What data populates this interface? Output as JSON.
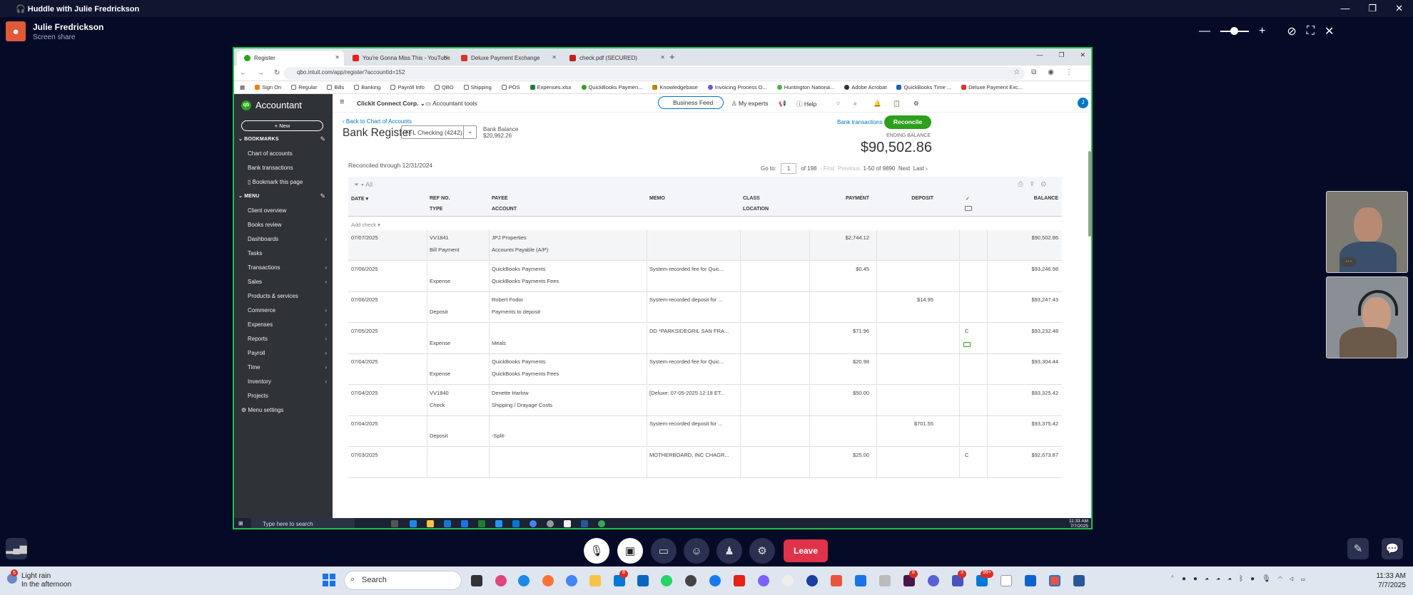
{
  "huddle": {
    "title": "Huddle with Julie Fredrickson",
    "presenter_name": "Julie Fredrickson",
    "presenter_status": "Screen share",
    "leave_label": "Leave",
    "participant_badge": "···"
  },
  "browser": {
    "tabs": [
      {
        "label": "Register",
        "color": "#2ca01c"
      },
      {
        "label": "You're Gonna Miss This - YouTube",
        "color": "#e62117"
      },
      {
        "label": "Deluxe Payment Exchange",
        "color": "#d9332c"
      },
      {
        "label": "check.pdf (SECURED)",
        "color": "#c41e1e"
      }
    ],
    "url": "qbo.intuit.com/app/register?accountId=152",
    "bookmarks": [
      "Sign On",
      "Regular",
      "Bills",
      "Banking",
      "Payroll Info",
      "QBO",
      "Shipping",
      "POS",
      "Expenses.xlsx",
      "QuickBooks Paymen...",
      "Knowledgebase",
      "Invoicing Process O...",
      "Huntington Nationa...",
      "Adobe Acrobat",
      "QuickBooks Time ...",
      "Deluxe Payment Exc..."
    ]
  },
  "qbo": {
    "brand": "Accountant",
    "new_label": "+ New",
    "company": "Clickit Connect Corp.",
    "accountant_tools": "Accountant tools",
    "business_feed": "Business Feed",
    "my_experts": "My experts",
    "help": "Help",
    "user_initial": "J",
    "bookmarks_header": "BOOKMARKS",
    "bookmark_items": [
      "Chart of accounts",
      "Bank transactions",
      "Bookmark this page"
    ],
    "menu_header": "MENU",
    "menu_items": [
      "Client overview",
      "Books review",
      "Dashboards",
      "Tasks",
      "Transactions",
      "Sales",
      "Products & services",
      "Commerce",
      "Expenses",
      "Reports",
      "Payroll",
      "Time",
      "Inventory",
      "Projects"
    ],
    "menu_settings": "Menu settings"
  },
  "register": {
    "back_link": "Back to Chart of Accounts",
    "title": "Bank Register",
    "account": "FFL Checking (4242)",
    "bank_balance_label": "Bank Balance",
    "bank_balance": "$20,962.26",
    "bank_transactions": "Bank transactions",
    "reconcile": "Reconcile",
    "ending_balance_label": "ENDING BALANCE",
    "ending_balance": "$90,502.86",
    "reconciled_through": "Reconciled through 12/31/2024",
    "goto_label": "Go to:",
    "goto_page": "1",
    "of_pages": "of 198",
    "first": "‹ First",
    "previous": "Previous",
    "range": "1-50 of 9890",
    "next": "Next",
    "last": "Last ›",
    "filter": "All",
    "add_check": "Add check",
    "headers": {
      "date": "DATE",
      "ref": "REF NO.",
      "type": "TYPE",
      "payee": "PAYEE",
      "account": "ACCOUNT",
      "memo": "MEMO",
      "class": "CLASS",
      "location": "LOCATION",
      "payment": "PAYMENT",
      "deposit": "DEPOSIT",
      "cleared": "✓",
      "balance": "BALANCE"
    },
    "rows": [
      {
        "date": "07/07/2025",
        "ref": "VV1841",
        "type": "Bill Payment",
        "payee": "JPJ Properties",
        "account": "Accounts Payable (A/P)",
        "memo": "",
        "payment": "$2,744.12",
        "deposit": "",
        "cleared": "",
        "balance": "$90,502.86"
      },
      {
        "date": "07/06/2025",
        "ref": "",
        "type": "Expense",
        "payee": "QuickBooks Payments",
        "account": "QuickBooks Payments Fees",
        "memo": "System-recorded fee for Quic...",
        "payment": "$0.45",
        "deposit": "",
        "cleared": "",
        "balance": "$93,246.98"
      },
      {
        "date": "07/06/2025",
        "ref": "",
        "type": "Deposit",
        "payee": "Robert Fodor",
        "account": "Payments to deposit",
        "memo": "System-recorded deposit for ...",
        "payment": "",
        "deposit": "$14.95",
        "cleared": "",
        "balance": "$93,247.43"
      },
      {
        "date": "07/05/2025",
        "ref": "",
        "type": "Expense",
        "payee": "",
        "account": "Meals",
        "memo": "DD *PARKSIDEGRIL SAN FRA...",
        "payment": "$71.96",
        "deposit": "",
        "cleared": "C",
        "balance": "$93,232.48"
      },
      {
        "date": "07/04/2025",
        "ref": "",
        "type": "Expense",
        "payee": "QuickBooks Payments",
        "account": "QuickBooks Payments Fees",
        "memo": "System-recorded fee for Quic...",
        "payment": "$20.98",
        "deposit": "",
        "cleared": "",
        "balance": "$93,304.44"
      },
      {
        "date": "07/04/2025",
        "ref": "VV1840",
        "type": "Check",
        "payee": "Denette Harlow",
        "account": "Shipping / Drayage Costs",
        "memo": "[Deluxe: 07-05-2025 12:18 ET...",
        "payment": "$50.00",
        "deposit": "",
        "cleared": "",
        "balance": "$93,325.42"
      },
      {
        "date": "07/04/2025",
        "ref": "",
        "type": "Deposit",
        "payee": "",
        "account": "-Split-",
        "memo": "System-recorded deposit for ...",
        "payment": "",
        "deposit": "$701.55",
        "cleared": "",
        "balance": "$93,375.42"
      },
      {
        "date": "07/03/2025",
        "ref": "",
        "type": "",
        "payee": "",
        "account": "",
        "memo": "MOTHERBOARD, INC CHAGR...",
        "payment": "$25.00",
        "deposit": "",
        "cleared": "C",
        "balance": "$92,673.87"
      }
    ]
  },
  "inner_taskbar": {
    "search": "Type here to search",
    "time": "11:33 AM",
    "date": "7/7/2025"
  },
  "windows": {
    "weather_title": "Light rain",
    "weather_sub": "In the afternoon",
    "weather_badge": "5",
    "search": "Search",
    "time": "11:33 AM",
    "date": "7/7/2025",
    "notif_a": "8",
    "notif_b": "3",
    "notif_c": "99+"
  }
}
